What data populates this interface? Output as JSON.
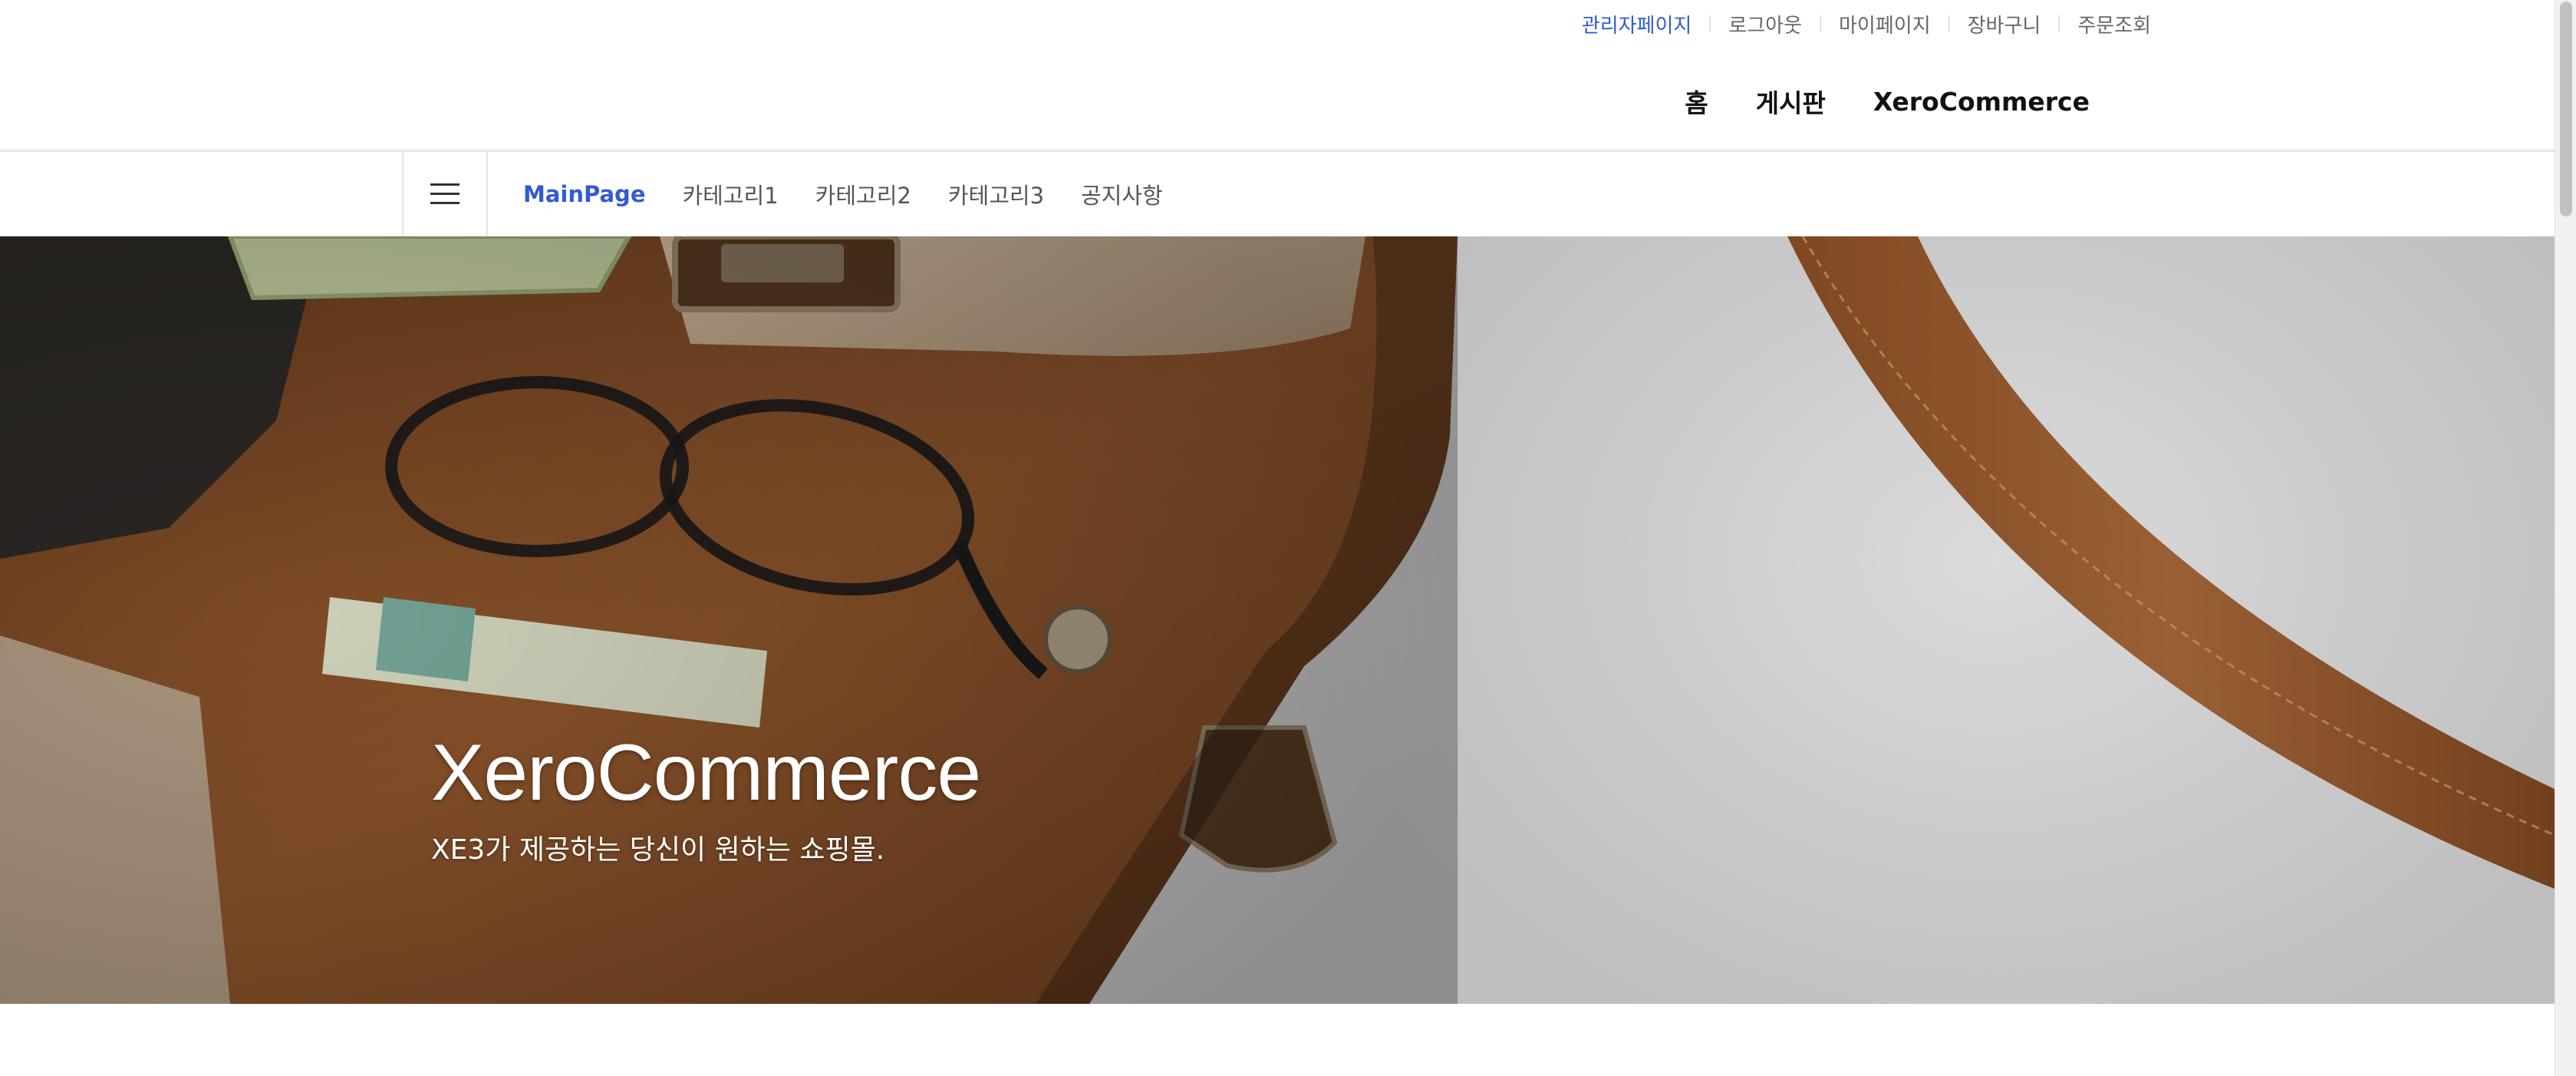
{
  "utility_nav": {
    "items": [
      {
        "label": "관리자페이지",
        "active": true
      },
      {
        "label": "로그아웃"
      },
      {
        "label": "마이페이지"
      },
      {
        "label": "장바구니"
      },
      {
        "label": "주문조회"
      }
    ]
  },
  "main_nav": {
    "items": [
      {
        "label": "홈"
      },
      {
        "label": "게시판"
      },
      {
        "label": "XeroCommerce"
      }
    ]
  },
  "category_nav": {
    "menu_icon": "hamburger-menu-icon",
    "items": [
      {
        "label": "MainPage",
        "active": true
      },
      {
        "label": "카테고리1"
      },
      {
        "label": "카테고리2"
      },
      {
        "label": "카테고리3"
      },
      {
        "label": "공지사항"
      }
    ]
  },
  "hero": {
    "title": "XeroCommerce",
    "subtitle": "XE3가 제공하는 당신이 원하는 쇼핑몰."
  },
  "colors": {
    "accent": "#2f5bd4",
    "leather": "#8a5530",
    "background": "#ffffff"
  }
}
